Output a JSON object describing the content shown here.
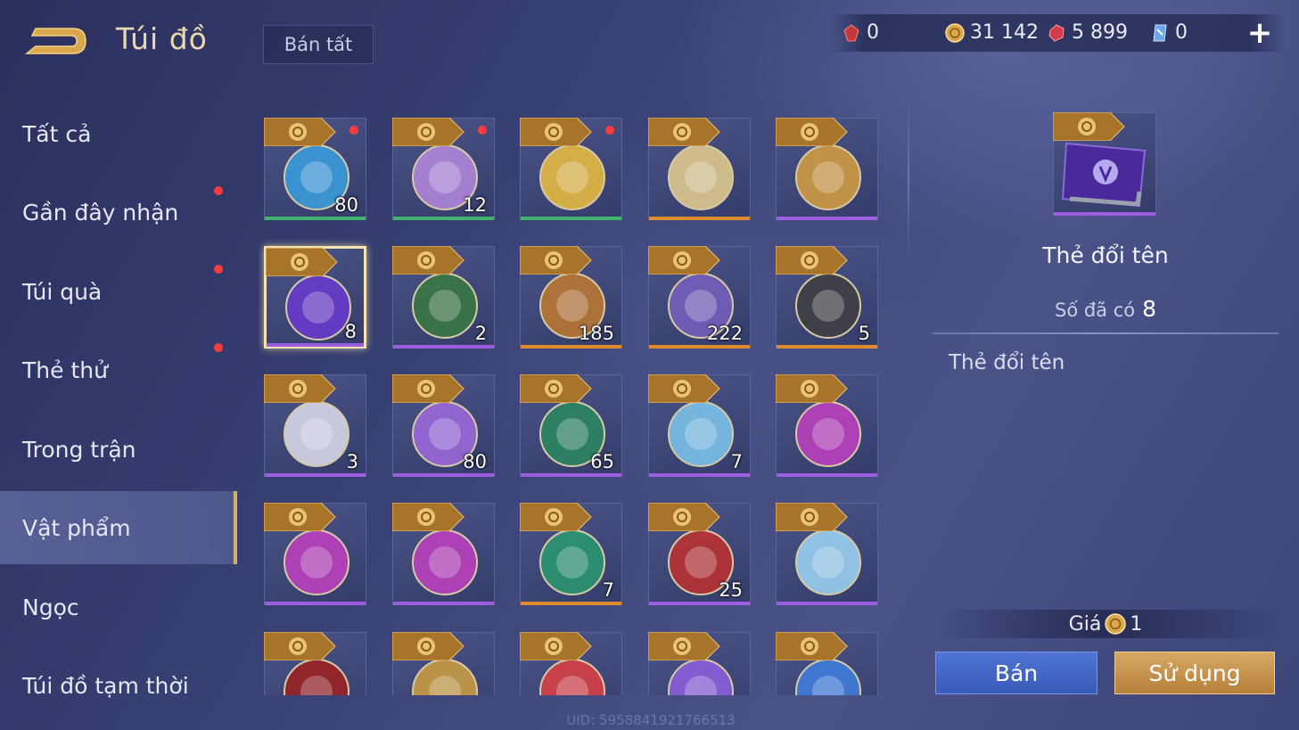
{
  "header": {
    "title": "Túi đồ",
    "sell_all_label": "Bán tất",
    "currencies": [
      {
        "icon": "red-gem-icon",
        "value": "0"
      },
      {
        "icon": "gold-coin-icon",
        "value": "31 142"
      },
      {
        "icon": "ruby-icon",
        "value": "5 899"
      },
      {
        "icon": "blue-card-icon",
        "value": "0"
      }
    ],
    "plus_label": "+"
  },
  "sidebar": {
    "items": [
      {
        "label": "Tất cả",
        "dot": false
      },
      {
        "label": "Gần đây nhận",
        "dot": true
      },
      {
        "label": "Túi quà",
        "dot": true
      },
      {
        "label": "Thẻ thử",
        "dot": true
      },
      {
        "label": "Trong trận",
        "dot": false
      },
      {
        "label": "Vật phẩm",
        "dot": false,
        "active": true
      },
      {
        "label": "Ngọc",
        "dot": false
      },
      {
        "label": "Túi đồ tạm thời",
        "dot": false
      }
    ]
  },
  "grid": {
    "items": [
      {
        "icon": "blue-orb-icon",
        "count": "80",
        "bar": "green",
        "dot": true
      },
      {
        "icon": "dice-icon",
        "count": "12",
        "bar": "green",
        "dot": true
      },
      {
        "icon": "lightning-icon",
        "count": "",
        "bar": "green",
        "dot": true
      },
      {
        "icon": "star-ticket-icon",
        "count": "",
        "bar": "orange",
        "dot": false
      },
      {
        "icon": "golden-hammer-icon",
        "count": "",
        "bar": "purple",
        "dot": false
      },
      {
        "icon": "rename-card-icon",
        "count": "8",
        "bar": "purple",
        "dot": false,
        "selected": true
      },
      {
        "icon": "double-coin-card-icon",
        "count": "2",
        "bar": "purple",
        "dot": false
      },
      {
        "icon": "treasure-pile-icon",
        "count": "185",
        "bar": "orange",
        "dot": false
      },
      {
        "icon": "knight-helmet-icon",
        "count": "222",
        "bar": "orange",
        "dot": false
      },
      {
        "icon": "hand-check-icon",
        "count": "5",
        "bar": "orange",
        "dot": false
      },
      {
        "icon": "crystal-sphere-icon",
        "count": "3",
        "bar": "purple",
        "dot": false
      },
      {
        "icon": "puzzle-piece-icon",
        "count": "80",
        "bar": "purple",
        "dot": false
      },
      {
        "icon": "hammer-medal-icon",
        "count": "65",
        "bar": "purple",
        "dot": false
      },
      {
        "icon": "ice-wings-icon",
        "count": "7",
        "bar": "purple",
        "dot": false
      },
      {
        "icon": "f3-badge-icon",
        "count": "",
        "bar": "purple",
        "dot": false
      },
      {
        "icon": "f2-badge-icon",
        "count": "",
        "bar": "purple",
        "dot": false
      },
      {
        "icon": "f1-badge-icon",
        "count": "",
        "bar": "purple",
        "dot": false
      },
      {
        "icon": "exit-door-icon",
        "count": "7",
        "bar": "orange",
        "dot": false
      },
      {
        "icon": "red-card-icon",
        "count": "25",
        "bar": "purple",
        "dot": false
      },
      {
        "icon": "ice-star-icon",
        "count": "",
        "bar": "purple",
        "dot": false
      },
      {
        "icon": "red-fabric-icon",
        "count": "",
        "bar": "none",
        "dot": false
      },
      {
        "icon": "star-medal-icon",
        "count": "",
        "bar": "none",
        "dot": false
      },
      {
        "icon": "red-gem-item-icon",
        "count": "",
        "bar": "none",
        "dot": false
      },
      {
        "icon": "n3-badge-icon",
        "count": "",
        "bar": "none",
        "dot": false
      },
      {
        "icon": "n2-badge-icon",
        "count": "",
        "bar": "none",
        "dot": false
      }
    ]
  },
  "detail": {
    "name": "Thẻ đổi tên",
    "owned_label": "Số đã có",
    "owned_value": "8",
    "description": "Thẻ đổi tên",
    "price_label": "Giá",
    "price_value": "1",
    "sell_label": "Bán",
    "use_label": "Sử dụng"
  },
  "footer": {
    "uid": "UID: 5958841921766513"
  },
  "colors": {
    "accent_gold": "#d9b26a",
    "sell_blue": "#4f74d4",
    "use_gold": "#d7a863",
    "notify_red": "#ff3b3b"
  }
}
